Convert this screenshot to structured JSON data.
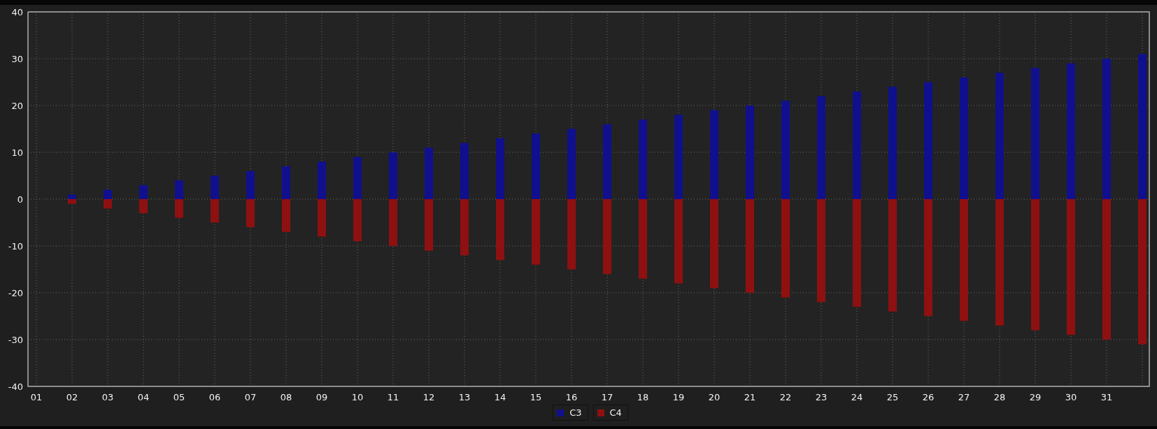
{
  "chart_data": {
    "type": "bar",
    "stacked": true,
    "grid": true,
    "x": [
      1,
      2,
      3,
      4,
      5,
      6,
      7,
      8,
      9,
      10,
      11,
      12,
      13,
      14,
      15,
      16,
      17,
      18,
      19,
      20,
      21,
      22,
      23,
      24,
      25,
      26,
      27,
      28,
      29,
      30,
      31,
      32
    ],
    "series": [
      {
        "name": "C3",
        "color": "#10108f",
        "values": [
          0,
          1,
          2,
          3,
          4,
          5,
          6,
          7,
          8,
          9,
          10,
          11,
          12,
          13,
          14,
          15,
          16,
          17,
          18,
          19,
          20,
          21,
          22,
          23,
          24,
          25,
          26,
          27,
          28,
          29,
          30,
          31
        ]
      },
      {
        "name": "C4",
        "color": "#8f1010",
        "values": [
          0,
          -1,
          -2,
          -3,
          -4,
          -5,
          -6,
          -7,
          -8,
          -9,
          -10,
          -11,
          -12,
          -13,
          -14,
          -15,
          -16,
          -17,
          -18,
          -19,
          -20,
          -21,
          -22,
          -23,
          -24,
          -25,
          -26,
          -27,
          -28,
          -29,
          -30,
          -31
        ]
      }
    ],
    "xlim": [
      1,
      32
    ],
    "ylim": [
      -40,
      40
    ],
    "xticks": [
      {
        "value": 1,
        "label": "01"
      },
      {
        "value": 2,
        "label": "02"
      },
      {
        "value": 3,
        "label": "03"
      },
      {
        "value": 4,
        "label": "04"
      },
      {
        "value": 5,
        "label": "05"
      },
      {
        "value": 6,
        "label": "06"
      },
      {
        "value": 7,
        "label": "07"
      },
      {
        "value": 8,
        "label": "08"
      },
      {
        "value": 9,
        "label": "09"
      },
      {
        "value": 10,
        "label": "10"
      },
      {
        "value": 11,
        "label": "11"
      },
      {
        "value": 12,
        "label": "12"
      },
      {
        "value": 13,
        "label": "13"
      },
      {
        "value": 14,
        "label": "14"
      },
      {
        "value": 15,
        "label": "15"
      },
      {
        "value": 16,
        "label": "16"
      },
      {
        "value": 17,
        "label": "17"
      },
      {
        "value": 18,
        "label": "18"
      },
      {
        "value": 19,
        "label": "19"
      },
      {
        "value": 20,
        "label": "20"
      },
      {
        "value": 21,
        "label": "21"
      },
      {
        "value": 22,
        "label": "22"
      },
      {
        "value": 23,
        "label": "23"
      },
      {
        "value": 24,
        "label": "24"
      },
      {
        "value": 25,
        "label": "25"
      },
      {
        "value": 26,
        "label": "26"
      },
      {
        "value": 27,
        "label": "27"
      },
      {
        "value": 28,
        "label": "28"
      },
      {
        "value": 29,
        "label": "29"
      },
      {
        "value": 30,
        "label": "30"
      },
      {
        "value": 31,
        "label": "31"
      }
    ],
    "yticks": [
      -40,
      -30,
      -20,
      -10,
      0,
      10,
      20,
      30,
      40
    ]
  }
}
